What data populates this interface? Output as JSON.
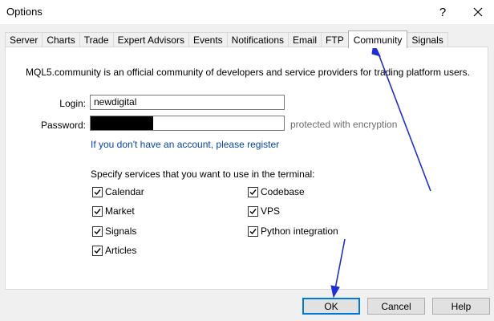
{
  "window": {
    "title": "Options",
    "help_glyph": "?"
  },
  "tabs": [
    {
      "label": "Server"
    },
    {
      "label": "Charts"
    },
    {
      "label": "Trade"
    },
    {
      "label": "Expert Advisors"
    },
    {
      "label": "Events"
    },
    {
      "label": "Notifications"
    },
    {
      "label": "Email"
    },
    {
      "label": "FTP"
    },
    {
      "label": "Community",
      "active": true
    },
    {
      "label": "Signals"
    }
  ],
  "community": {
    "description": "MQL5.community is an official community of developers and service providers for trading platform users.",
    "login_label": "Login:",
    "login_value": "newdigital",
    "password_label": "Password:",
    "password_note": "protected with encryption",
    "register_link": "If you don't have an account, please register",
    "services_label": "Specify services that you want to use in the terminal:",
    "services": [
      {
        "label": "Calendar",
        "checked": true
      },
      {
        "label": "Market",
        "checked": true
      },
      {
        "label": "Signals",
        "checked": true
      },
      {
        "label": "Articles",
        "checked": true
      },
      {
        "label": "Codebase",
        "checked": true
      },
      {
        "label": "VPS",
        "checked": true
      },
      {
        "label": "Python integration",
        "checked": true
      }
    ]
  },
  "buttons": {
    "ok": "OK",
    "cancel": "Cancel",
    "help": "Help"
  },
  "colors": {
    "link": "#0645ad",
    "annotation_arrow": "#1f2fd6",
    "focus_border": "#0078d7"
  },
  "icons": {
    "close": "close-icon",
    "check": "check-icon"
  }
}
